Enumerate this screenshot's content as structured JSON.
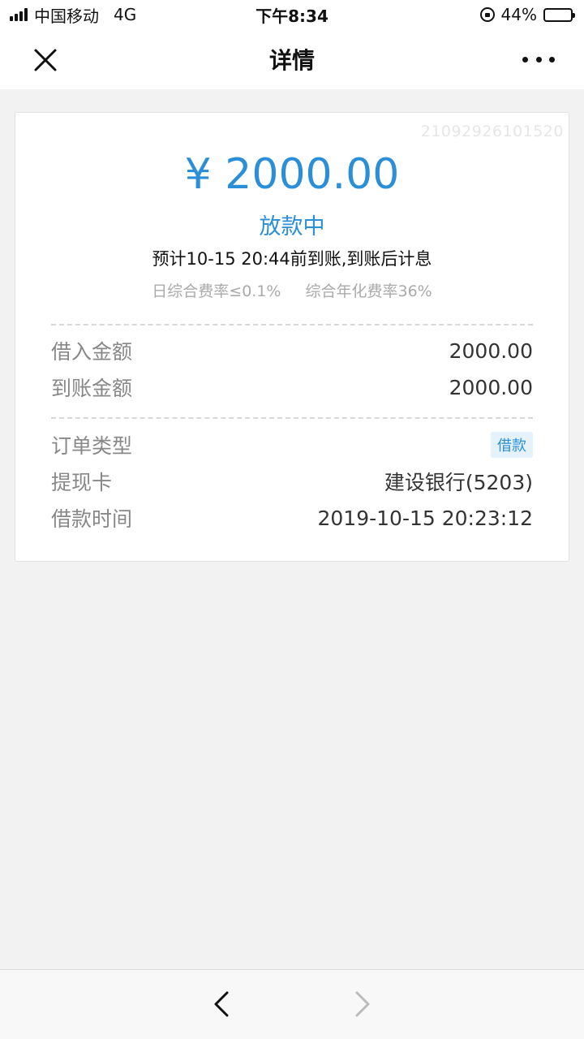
{
  "status_bar": {
    "carrier": "中国移动",
    "network": "4G",
    "time": "下午8:34",
    "battery": "44%",
    "battery_level": 0.44
  },
  "nav": {
    "title": "详情"
  },
  "order": {
    "number": "21092926101520",
    "amount": "¥ 2000.00",
    "status": "放款中",
    "eta": "预计10-15 20:44前到账,到账后计息",
    "daily_rate": "日综合费率≤0.1%",
    "annual_rate": "综合年化费率36%"
  },
  "details": {
    "borrow_amount_label": "借入金额",
    "borrow_amount_value": "2000.00",
    "arrival_amount_label": "到账金额",
    "arrival_amount_value": "2000.00",
    "order_type_label": "订单类型",
    "order_type_value": "借款",
    "card_label": "提现卡",
    "card_value": "建设银行(5203)",
    "time_label": "借款时间",
    "time_value": "2019-10-15 20:23:12"
  },
  "colors": {
    "accent": "#2a8fd6",
    "page_bg": "#f2f2f2"
  }
}
